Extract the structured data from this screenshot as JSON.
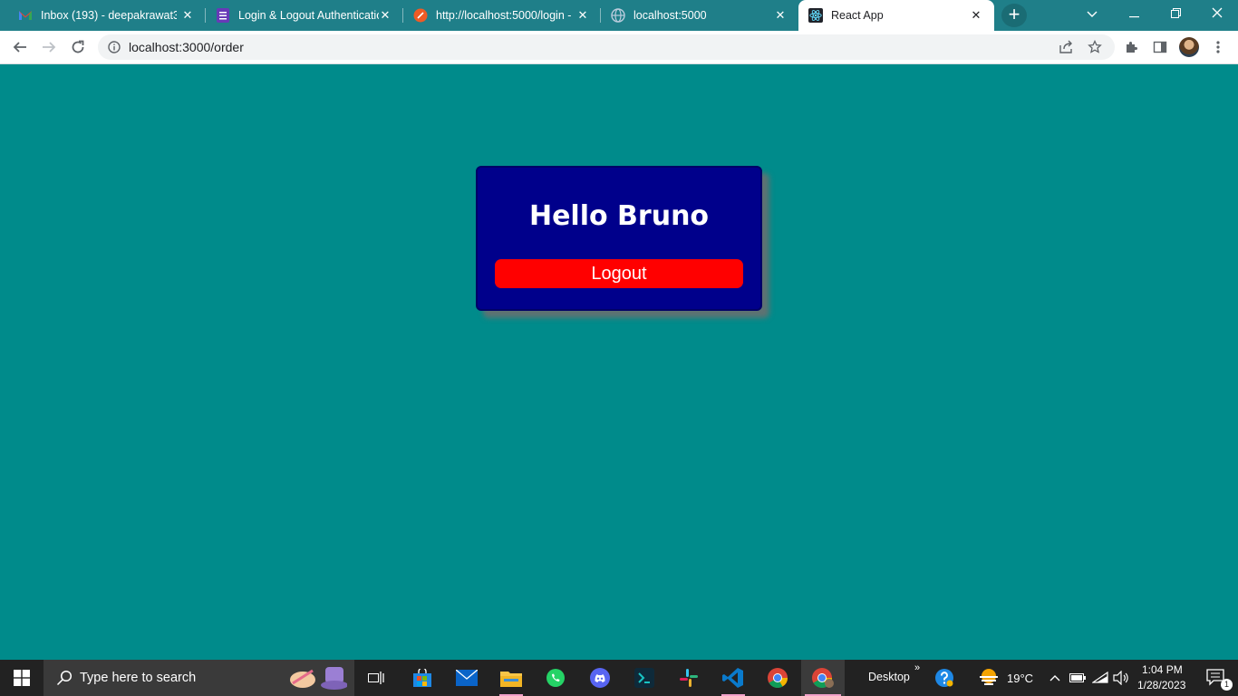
{
  "browser": {
    "tabs": [
      {
        "title": "Inbox (193) - deepakrawat37",
        "icon": "gmail-icon"
      },
      {
        "title": "Login & Logout Authenticatio",
        "icon": "forms-icon"
      },
      {
        "title": "http://localhost:5000/login -",
        "icon": "postman-icon"
      },
      {
        "title": "localhost:5000",
        "icon": "globe-icon"
      },
      {
        "title": "React App",
        "icon": "react-icon"
      }
    ],
    "url": "localhost:3000/order",
    "close_glyph": "✕",
    "new_tab_glyph": "+"
  },
  "page": {
    "greeting": "Hello Bruno",
    "logout_label": "Logout",
    "colors": {
      "background": "#008b8b",
      "card": "#00008b",
      "button": "#ff0000"
    }
  },
  "taskbar": {
    "search_placeholder": "Type here to search",
    "desktop_label": "Desktop",
    "weather_temp": "19°C",
    "time": "1:04 PM",
    "date": "1/28/2023",
    "notification_count": "1"
  }
}
